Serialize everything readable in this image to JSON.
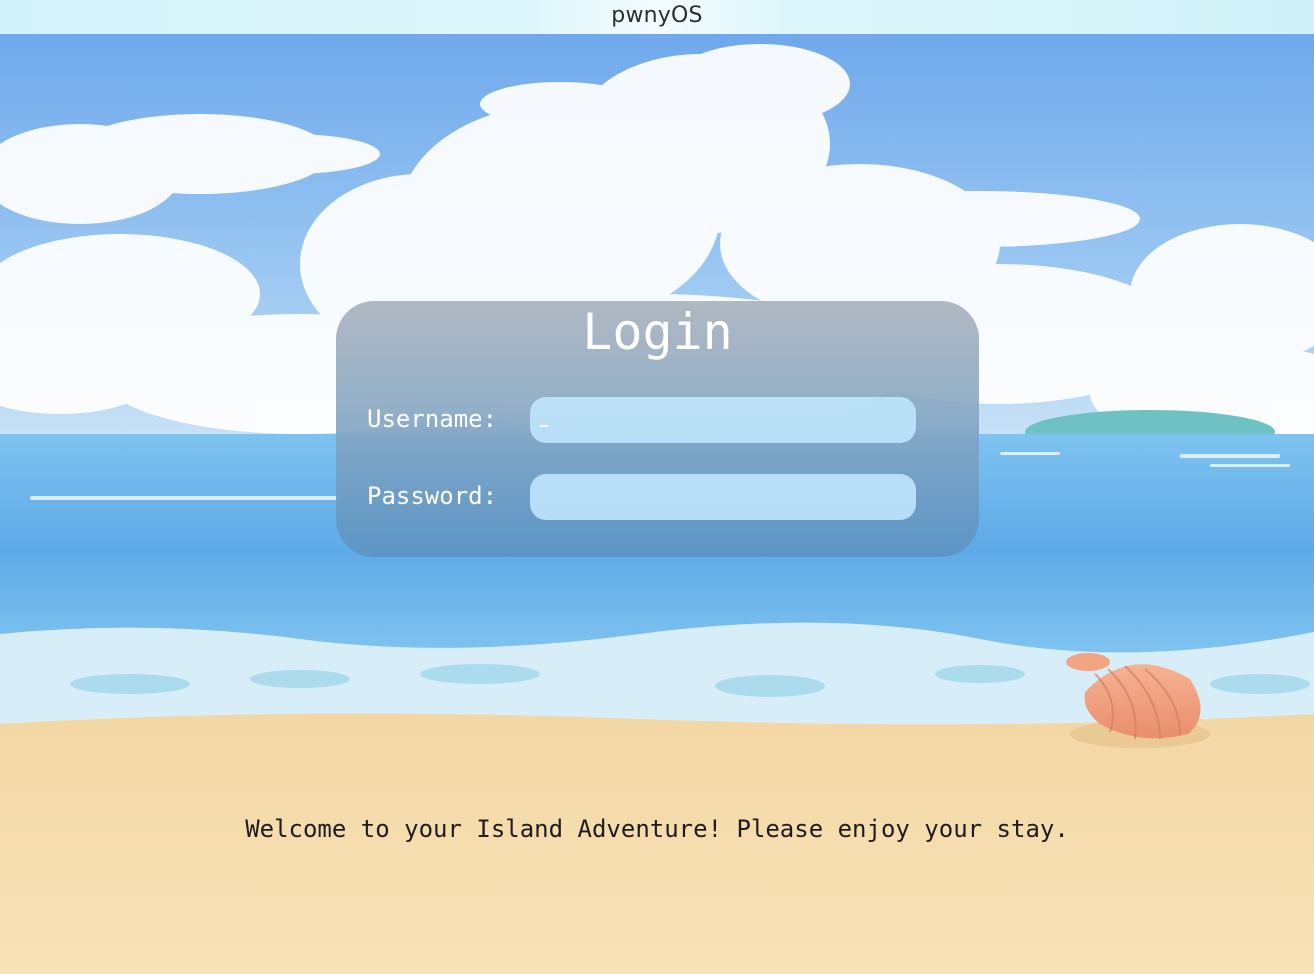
{
  "window": {
    "title": "pwnyOS"
  },
  "login": {
    "title": "Login",
    "username_label": "Username:",
    "username_value": "",
    "password_label": "Password:",
    "password_value": ""
  },
  "welcome": {
    "message": "Welcome to your Island Adventure! Please enjoy your stay."
  },
  "colors": {
    "sky": "#7fb6ee",
    "sea": "#5fa8e8",
    "sand": "#f6deb0",
    "panel": "#5c94c4"
  },
  "icons": {
    "shell": "seashell-icon"
  }
}
